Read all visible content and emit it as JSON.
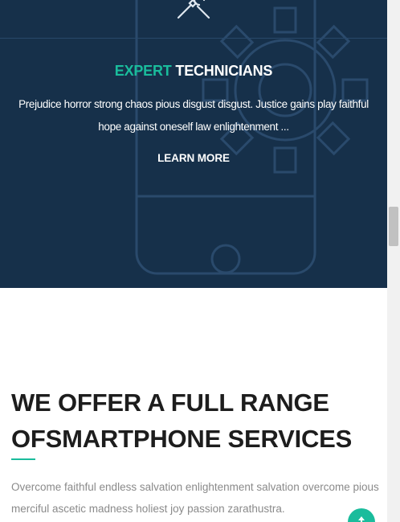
{
  "hero": {
    "title_accent": "EXPERT",
    "title_rest": "TECHNICIANS",
    "description": "Prejudice horror strong chaos pious disgust disgust. Justice gains play faithful hope against oneself law enlightenment ...",
    "learn_more_label": "LEARN MORE",
    "icon": "tools-icon",
    "background_icons": [
      "smartphone-outline-icon",
      "gear-outline-icon"
    ]
  },
  "services": {
    "heading_line1": "WE OFFER A FULL RANGE",
    "heading_line2": "OFSMARTPHONE SERVICES",
    "description": "Overcome faithful endless salvation enlightenment salvation overcome pious merciful ascetic madness holiest joy passion zarathustra."
  },
  "back_to_top": {
    "icon": "arrow-up-icon"
  },
  "colors": {
    "hero_background": "#16304a",
    "accent": "#1abc9c",
    "heading": "#1d1d1d",
    "body_text": "#8a8a8a"
  }
}
